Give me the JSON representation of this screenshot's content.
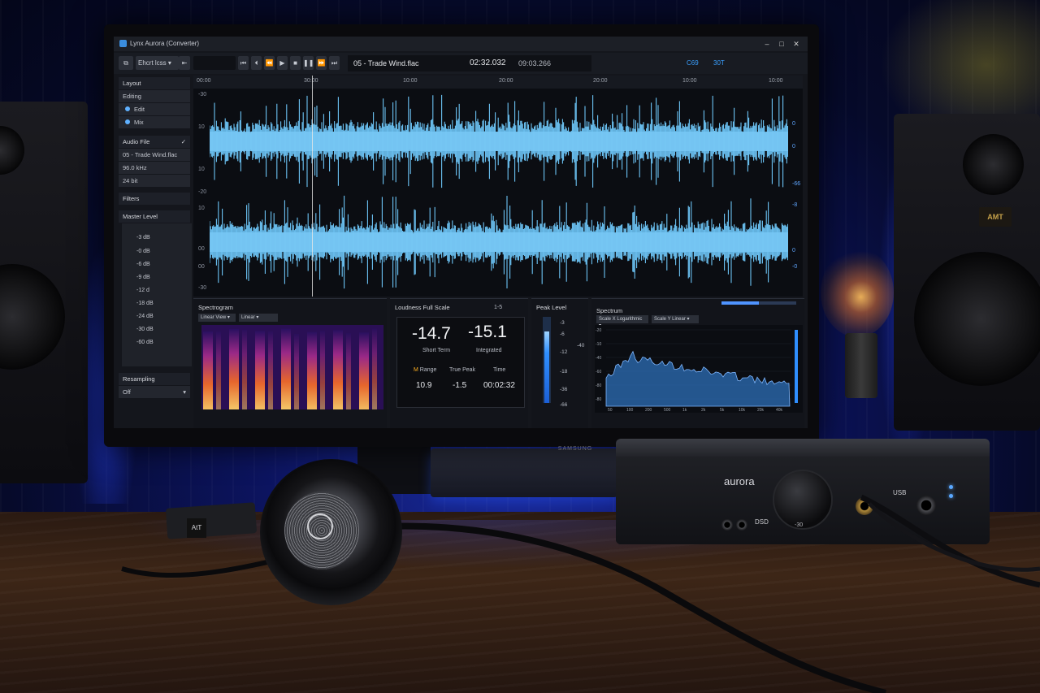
{
  "window": {
    "title": "Lynx Aurora (Converter)",
    "minimize": "–",
    "maximize": "□",
    "close": "✕"
  },
  "toolbar": {
    "menu_label": "Ehcrt lcss",
    "current_file": "05 - Trade Wind.flac",
    "position": "02:32.032",
    "duration": "09:03.266",
    "stat1": "C69",
    "stat2": "30T"
  },
  "left_panel": {
    "layout_title": "Layout",
    "editing": "Editing",
    "edit": "Edit",
    "mix": "Mix",
    "audio_file_title": "Audio File",
    "file_name": "05 - Trade Wind.flac",
    "sample_rate": "96.0 kHz",
    "bit_depth": "24 bit",
    "filters_title": "Filters",
    "master_level_title": "Master Level",
    "levels": [
      "-3 dB",
      "-0 dB",
      "-6 dB",
      "-9 dB",
      "-12 d",
      "-18 dB",
      "-24 dB",
      "-30 dB",
      "-60 dB"
    ],
    "resampling_title": "Resampling",
    "resampling_value": "Off"
  },
  "timeline": {
    "ticks": [
      "00:00",
      "30:00",
      "10:00",
      "20:00",
      "20:00",
      "10:00",
      "10:00"
    ],
    "left_scale": [
      "-30",
      "10",
      "10",
      "-20",
      "10",
      "00",
      "00",
      "-30"
    ],
    "right_scale": [
      "0",
      "0",
      "-66",
      "-8",
      "0",
      "-0"
    ]
  },
  "spectrogram": {
    "title": "Spectrogram",
    "view": "Linear View",
    "scale": "Linear"
  },
  "loudness": {
    "title": "Loudness Full Scale",
    "extra": "1-5",
    "short_term_value": "-14.7",
    "short_term_label": "Short Term",
    "integrated_value": "-15.1",
    "integrated_label": "Integrated",
    "range_label": "Range",
    "range_prefix": "M",
    "range_value": "10.9",
    "true_peak_label": "True Peak",
    "true_peak_value": "-1.5",
    "time_label": "Time",
    "time_value": "00:02:32"
  },
  "peak_level": {
    "title": "Peak Level",
    "scale": [
      "-3",
      "-6",
      "-12",
      "-18",
      "-36",
      "-66"
    ],
    "side_label": "-40"
  },
  "spectrum": {
    "title": "Spectrum",
    "scale_x_label": "Scale X",
    "scale_x_value": "Logarithmic",
    "scale_y_label": "Scale Y",
    "scale_y_value": "Linear",
    "y_ticks": [
      "-20",
      "-10",
      "-40",
      "-60",
      "-80",
      "-80"
    ],
    "x_ticks": [
      "50",
      "100",
      "200",
      "500",
      "1k",
      "2k",
      "5k",
      "10k",
      "20k",
      "40k"
    ]
  },
  "hardware": {
    "monitor_brand": "SAMSUNG",
    "dac_brand": "aurora",
    "knob_label": "-30",
    "dac_dsd": "DSD",
    "dac_usb": "USB",
    "speaker_logo": "AMT",
    "headphone_tag": "AtT"
  }
}
